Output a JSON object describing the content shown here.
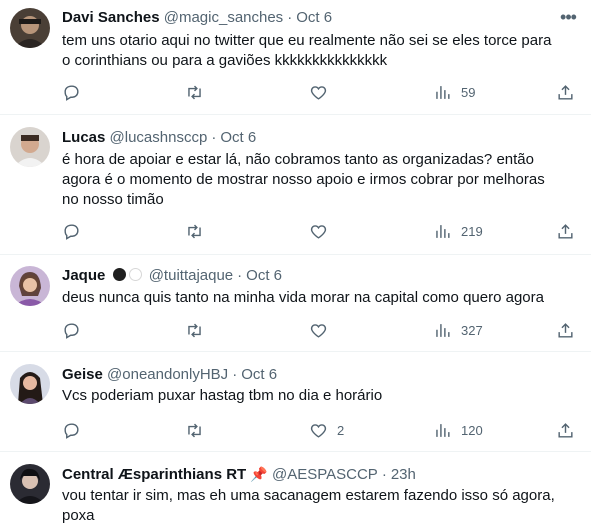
{
  "tweets": [
    {
      "name": "Davi Sanches",
      "handle": "@magic_sanches",
      "time": "Oct 6",
      "text": "tem uns otario aqui no twitter que eu realmente não sei se eles torce para\no corinthians ou para a gaviões kkkkkkkkkkkkkkk",
      "replies": "",
      "retweets": "",
      "likes": "",
      "views": "59"
    },
    {
      "name": "Lucas",
      "handle": "@lucashnsccp",
      "time": "Oct 6",
      "text": "é hora de apoiar e estar lá, não cobramos tanto as organizadas? então\nagora é o momento de mostrar nosso apoio e irmos cobrar por melhoras\nno nosso timão",
      "replies": "",
      "retweets": "",
      "likes": "",
      "views": "219"
    },
    {
      "name": "Jaque",
      "handle": "@tuittajaque",
      "time": "Oct 6",
      "text": "deus nunca quis tanto na minha vida  morar na capital como quero agora",
      "replies": "",
      "retweets": "",
      "likes": "",
      "views": "327",
      "name_badges": [
        "black-circle",
        "white-circle"
      ]
    },
    {
      "name": "Geise",
      "handle": "@oneandonlyHBJ",
      "time": "Oct 6",
      "text": "Vcs poderiam puxar hastag tbm no dia e horário",
      "replies": "",
      "retweets": "",
      "likes": "2",
      "views": "120"
    },
    {
      "name": "Central Æsparinthians RT",
      "name_emoji": "📌",
      "handle": "@AESPASCCP",
      "time": "23h",
      "text": "vou tentar ir sim, mas eh uma sacanagem estarem fazendo isso só agora,\npoxa"
    }
  ],
  "icons": {
    "reply": "reply-icon",
    "retweet": "retweet-icon",
    "like": "heart-icon",
    "views": "views-chart-icon",
    "share": "share-icon",
    "more": "more-icon"
  },
  "colors": {
    "text": "#0f1419",
    "secondary": "#536471",
    "divider": "#eff3f4"
  }
}
